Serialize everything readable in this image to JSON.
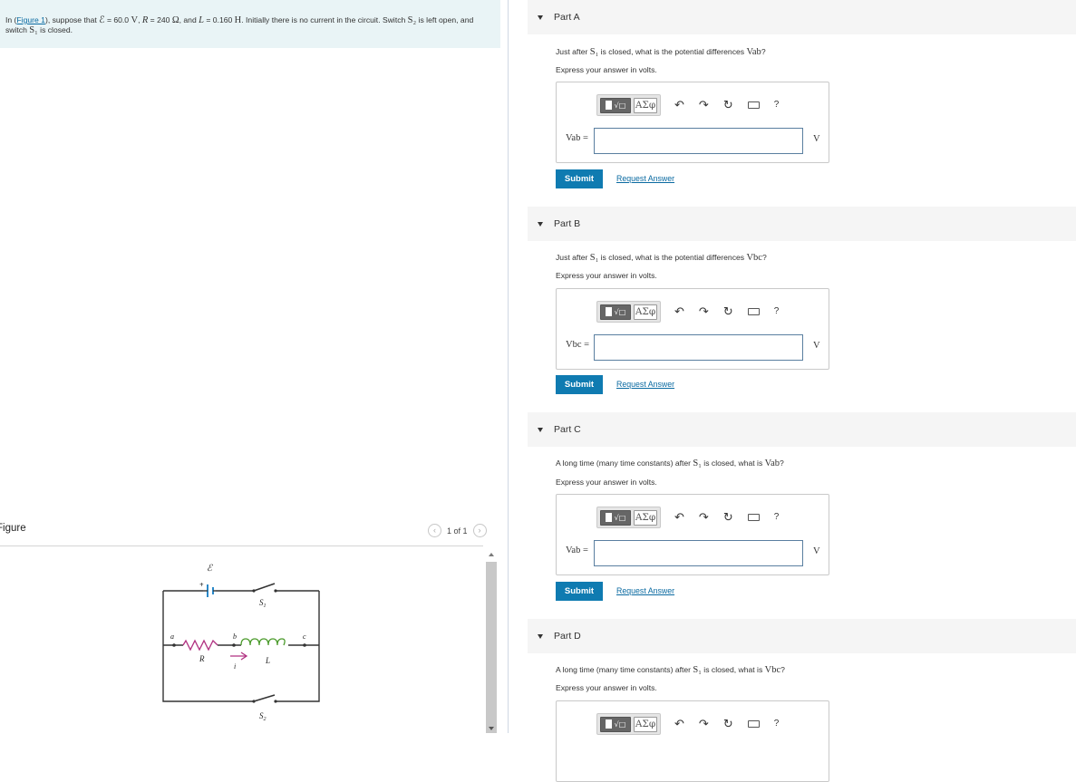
{
  "intro": {
    "before_link": "In (",
    "link": "Figure 1",
    "after_link": "), suppose that ",
    "emf_symbol": "ℰ",
    "emf_value": " = 60.0 ",
    "emf_unit": "V",
    "sep1": ", ",
    "r_symbol": "R",
    "r_value": " = 240 ",
    "r_unit": "Ω",
    "sep2": ", and ",
    "l_symbol": "L",
    "l_value": " = 0.160 ",
    "l_unit": "H",
    "rest1": ". Initially there is no current in the circuit. Switch ",
    "s2": "S₂",
    "rest2": " is left open, and switch ",
    "s1": "S₁",
    "rest3": " is closed."
  },
  "figure": {
    "label": "Figure",
    "pager_text": "1 of 1",
    "prev_icon": "chevron-left-icon",
    "next_icon": "chevron-right-icon",
    "circuit_labels": {
      "emf": "ℰ",
      "plus": "+",
      "s1": "S",
      "s1_sub": "1",
      "s2": "S",
      "s2_sub": "2",
      "a": "a",
      "b": "b",
      "c": "c",
      "R": "R",
      "L": "L",
      "i": "i"
    },
    "colors": {
      "wire": "#333333",
      "battery": "#2a88c8",
      "resistor": "#b03080",
      "inductor": "#4a9a2a",
      "current_arrow": "#b03080"
    }
  },
  "parts": [
    {
      "header": "Part A",
      "question_pre": "Just after ",
      "question_sym": "S₁",
      "question_mid": " is closed, what is the potential differences ",
      "question_var": "Vab",
      "question_post": "?",
      "instruction": "Express your answer in volts.",
      "var_label": "Vab =",
      "input_value": "",
      "unit": "V",
      "submit": "Submit",
      "request": "Request Answer"
    },
    {
      "header": "Part B",
      "question_pre": "Just after ",
      "question_sym": "S₁",
      "question_mid": " is closed, what is the potential differences ",
      "question_var": "Vbc",
      "question_post": "?",
      "instruction": "Express your answer in volts.",
      "var_label": "Vbc =",
      "input_value": "",
      "unit": "V",
      "submit": "Submit",
      "request": "Request Answer"
    },
    {
      "header": "Part C",
      "question_pre": "A long time (many time constants) after ",
      "question_sym": "S₁",
      "question_mid": " is closed, what is ",
      "question_var": "Vab",
      "question_post": "?",
      "instruction": "Express your answer in volts.",
      "var_label": "Vab =",
      "input_value": "",
      "unit": "V",
      "submit": "Submit",
      "request": "Request Answer"
    },
    {
      "header": "Part D",
      "question_pre": "A long time (many time constants) after ",
      "question_sym": "S₁",
      "question_mid": " is closed, what is ",
      "question_var": "Vbc",
      "question_post": "?",
      "instruction": "Express your answer in volts.",
      "var_label": "Vbc =",
      "input_value": "",
      "unit": "V",
      "submit": "Submit",
      "request": "Request Answer"
    }
  ],
  "toolbar": {
    "template_icon": "fraction-sqrt-template-icon",
    "greek_label": "ΑΣφ",
    "undo_icon": "undo-icon",
    "redo_icon": "redo-icon",
    "reset_icon": "reset-icon",
    "keyboard_icon": "keyboard-icon",
    "help_label": "?"
  }
}
